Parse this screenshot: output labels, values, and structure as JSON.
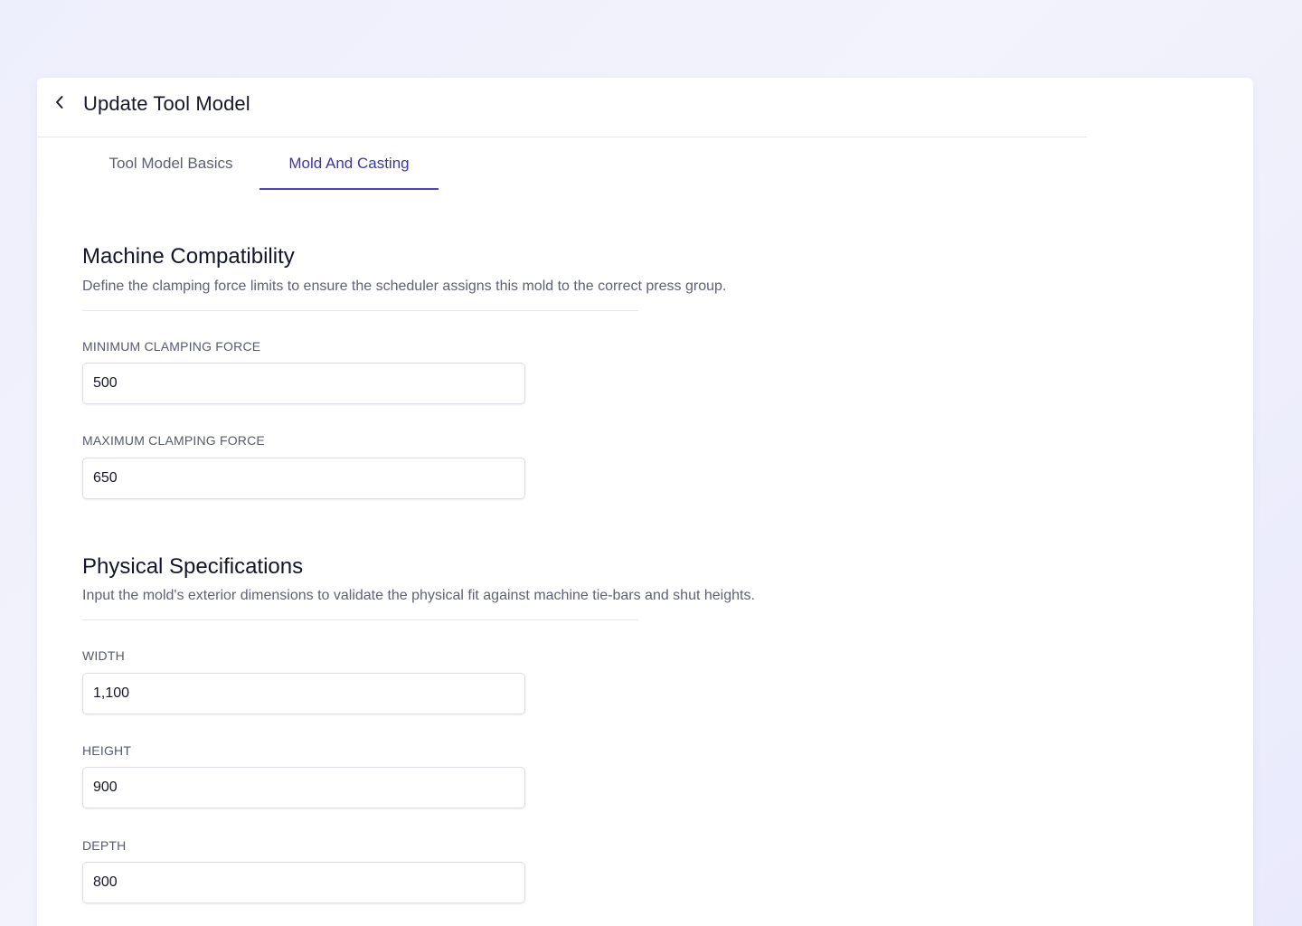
{
  "header": {
    "back_icon": "chevron-left-icon",
    "title": "Update Tool Model"
  },
  "tabs": [
    {
      "label": "Tool Model Basics",
      "active": false
    },
    {
      "label": "Mold And Casting",
      "active": true
    }
  ],
  "colors": {
    "accent": "#4a43c8",
    "active_tab_text": "#3a35b0",
    "inactive_tab_text": "#5c5f73"
  },
  "machine_compatibility": {
    "title": "Machine Compatibility",
    "description": "Define the clamping force limits to ensure the scheduler assigns this mold to the correct press group.",
    "fields": {
      "min_clamping": {
        "label": "MINIMUM CLAMPING FORCE",
        "value": "500"
      },
      "max_clamping": {
        "label": "MAXIMUM CLAMPING FORCE",
        "value": "650"
      }
    }
  },
  "physical_specifications": {
    "title": "Physical Specifications",
    "description": "Input the mold's exterior dimensions to validate the physical fit against machine tie-bars and shut heights.",
    "fields": {
      "width": {
        "label": "WIDTH",
        "value": "1,100"
      },
      "height": {
        "label": "HEIGHT",
        "value": "900"
      },
      "depth": {
        "label": "DEPTH",
        "value": "800"
      }
    }
  }
}
